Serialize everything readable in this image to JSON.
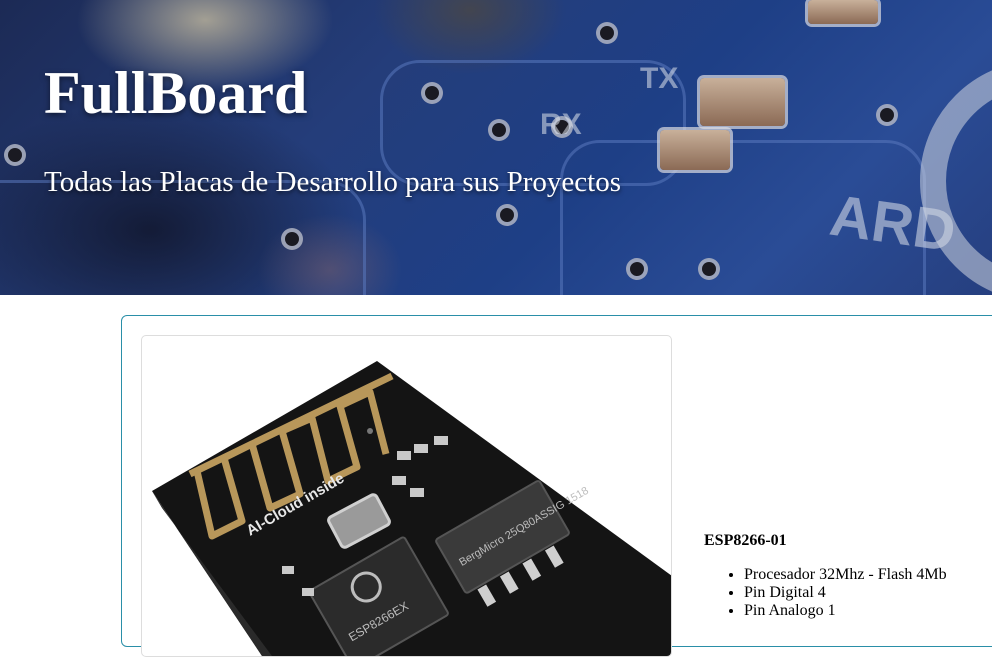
{
  "header": {
    "title": "FullBoard",
    "subtitle": "Todas las Placas de Desarrollo para sus Proyectos"
  },
  "product": {
    "name": "ESP8266-01",
    "specs": [
      "Procesador 32Mhz - Flash 4Mb",
      "Pin Digital 4",
      "Pin Analogo 1"
    ],
    "image": {
      "antenna_label": "AI-Cloud inside",
      "chip_label": "ESP8266EX",
      "flash_label": "BergMicro 25Q80ASSIG 1518"
    }
  },
  "colors": {
    "card_border": "#2a8fa8",
    "board": "#141414",
    "antenna": "#b8975a"
  }
}
